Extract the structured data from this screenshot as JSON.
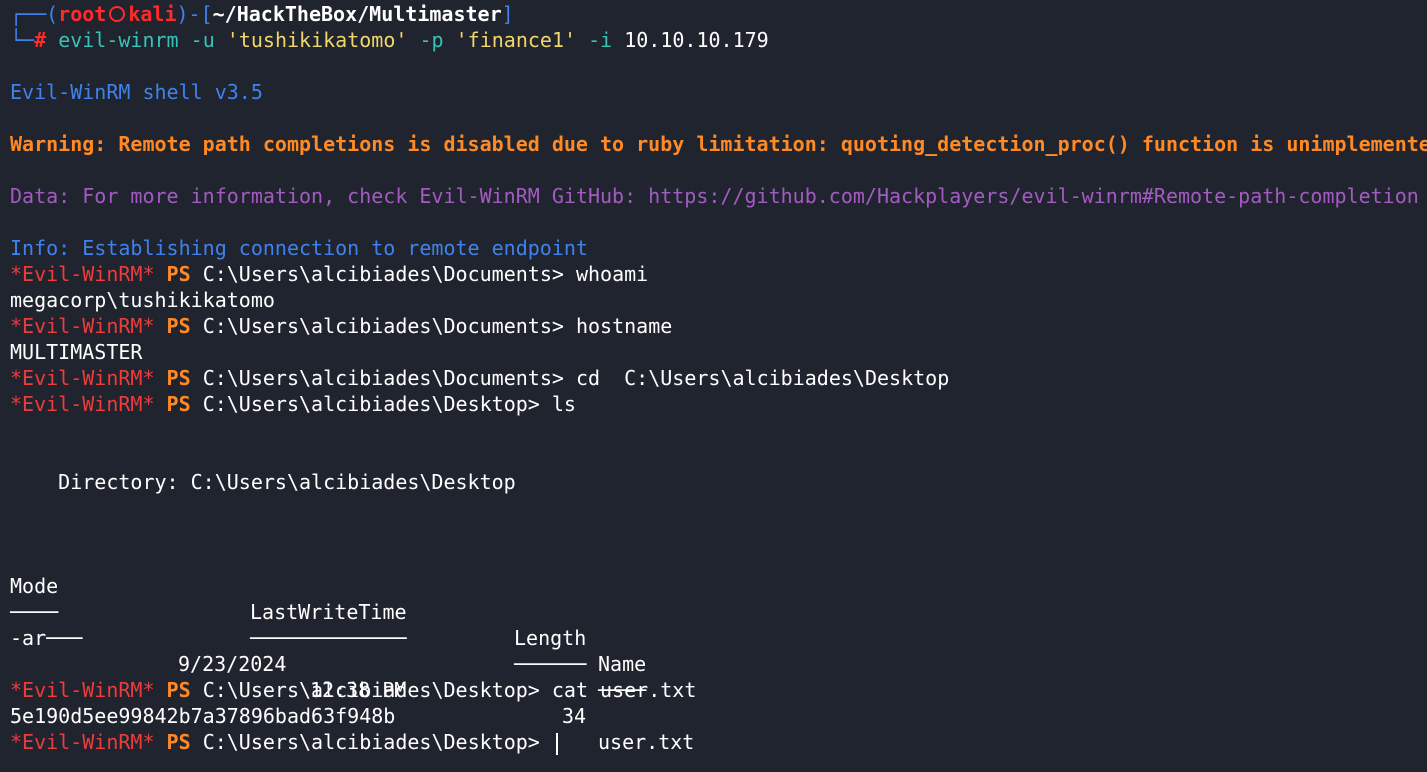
{
  "prompt": {
    "user": "root",
    "host": "kali",
    "path": "~/HackTheBox/Multimaster",
    "hash": "#",
    "cmd_bin": "evil-winrm",
    "cmd_flag_u": "-u",
    "cmd_user": "'tushikikatomo'",
    "cmd_flag_p": "-p",
    "cmd_pass": "'finance1'",
    "cmd_flag_i": "-i",
    "cmd_ip": "10.10.10.179"
  },
  "banner": "Evil-WinRM shell v3.5",
  "warning": "Warning: Remote path completions is disabled due to ruby limitation: quoting_detection_proc() function is unimplemented",
  "data_line": "Data: For more information, check Evil-WinRM GitHub: https://github.com/Hackplayers/evil-winrm#Remote-path-completion",
  "info_line": "Info: Establishing connection to remote endpoint",
  "shell_tag": "*Evil-WinRM*",
  "ps_tag": "PS",
  "commands": [
    {
      "path": "C:\\Users\\alcibiades\\Documents>",
      "cmd": "whoami",
      "output": "megacorp\\tushikikatomo"
    },
    {
      "path": "C:\\Users\\alcibiades\\Documents>",
      "cmd": "hostname",
      "output": "MULTIMASTER"
    },
    {
      "path": "C:\\Users\\alcibiades\\Documents>",
      "cmd": "cd  C:\\Users\\alcibiades\\Desktop",
      "output": ""
    },
    {
      "path": "C:\\Users\\alcibiades\\Desktop>",
      "cmd": "ls",
      "output": ""
    },
    {
      "path": "C:\\Users\\alcibiades\\Desktop>",
      "cmd": "cat user.txt",
      "output": "5e190d5ee99842b7a37896bad63f948b"
    },
    {
      "path": "C:\\Users\\alcibiades\\Desktop>",
      "cmd": "",
      "output": ""
    }
  ],
  "directory": {
    "label": "    Directory: C:\\Users\\alcibiades\\Desktop",
    "headers": {
      "mode": "Mode",
      "lastwrite": "LastWriteTime",
      "length": "Length",
      "name": "Name"
    },
    "underlines": {
      "mode": "────",
      "lastwrite": "─────────────",
      "length": "──────",
      "name": "────"
    },
    "rows": [
      {
        "mode": "-ar───",
        "date": "9/23/2024",
        "time": "12:38 PM",
        "length": "34",
        "name": "user.txt"
      }
    ]
  }
}
